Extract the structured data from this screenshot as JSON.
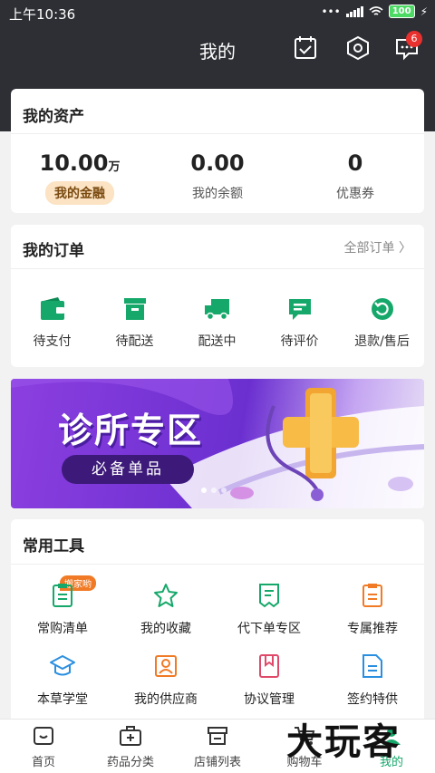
{
  "status_bar": {
    "time": "上午10:36",
    "battery": "100"
  },
  "header": {
    "title": "我的",
    "message_badge": "6"
  },
  "assets": {
    "title": "我的资产",
    "items": [
      {
        "value": "10.00",
        "unit": "万",
        "label": "我的金融"
      },
      {
        "value": "0.00",
        "unit": "",
        "label": "我的余额"
      },
      {
        "value": "0",
        "unit": "",
        "label": "优惠券"
      }
    ]
  },
  "orders": {
    "title": "我的订单",
    "all_label": "全部订单",
    "items": [
      {
        "label": "待支付",
        "icon": "wallet-icon"
      },
      {
        "label": "待配送",
        "icon": "box-icon"
      },
      {
        "label": "配送中",
        "icon": "truck-icon"
      },
      {
        "label": "待评价",
        "icon": "comment-icon"
      },
      {
        "label": "退款/售后",
        "icon": "refund-icon"
      }
    ]
  },
  "banner": {
    "title": "诊所专区",
    "subtitle": "必备单品"
  },
  "tools": {
    "title": "常用工具",
    "tag": "搬家哟",
    "items": [
      {
        "label": "常购清单",
        "icon": "clipboard-icon"
      },
      {
        "label": "我的收藏",
        "icon": "star-icon"
      },
      {
        "label": "代下单专区",
        "icon": "receipt-icon"
      },
      {
        "label": "专属推荐",
        "icon": "recommend-icon"
      },
      {
        "label": "本草学堂",
        "icon": "graduation-cap-icon"
      },
      {
        "label": "我的供应商",
        "icon": "supplier-icon"
      },
      {
        "label": "协议管理",
        "icon": "bookmark-icon"
      },
      {
        "label": "签约特供",
        "icon": "document-icon"
      }
    ]
  },
  "tabbar": {
    "items": [
      {
        "label": "首页",
        "icon": "home-icon"
      },
      {
        "label": "药品分类",
        "icon": "medkit-icon"
      },
      {
        "label": "店铺列表",
        "icon": "shop-icon"
      },
      {
        "label": "购物车",
        "icon": "cart-icon"
      },
      {
        "label": "我的",
        "icon": "profile-icon"
      }
    ]
  },
  "watermark": "大玩客",
  "colors": {
    "brand_green": "#16a86a",
    "header_dark": "#2e2f34",
    "badge_red": "#e8312f",
    "tag_orange": "#f07a25"
  }
}
